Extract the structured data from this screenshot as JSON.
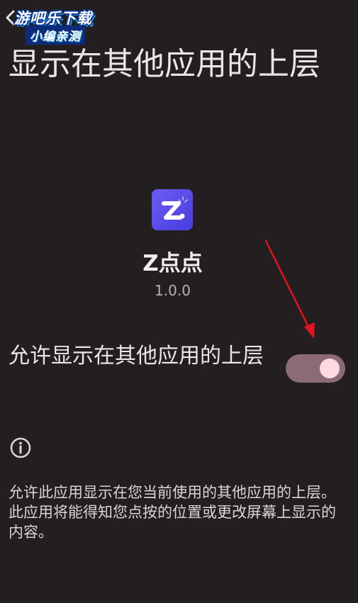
{
  "header": {
    "back_icon": "arrow-back-icon",
    "watermark_line1": "游吧乐下载",
    "watermark_line2": "小编亲测",
    "title": "显示在其他应用的上层"
  },
  "app": {
    "icon": "z-app-icon",
    "name": "Z点点",
    "version": "1.0.0"
  },
  "setting": {
    "label": "允许显示在其他应用的上层",
    "enabled": true
  },
  "info": {
    "icon": "info-icon",
    "description": "允许此应用显示在您当前使用的其他应用的上层。此应用将能得知您点按的位置或更改屏幕上显示的内容。"
  },
  "colors": {
    "background": "#231e20",
    "toggle_track": "#8c6b74",
    "toggle_thumb": "#ffd9e2",
    "annotation_arrow": "#e0141c"
  }
}
